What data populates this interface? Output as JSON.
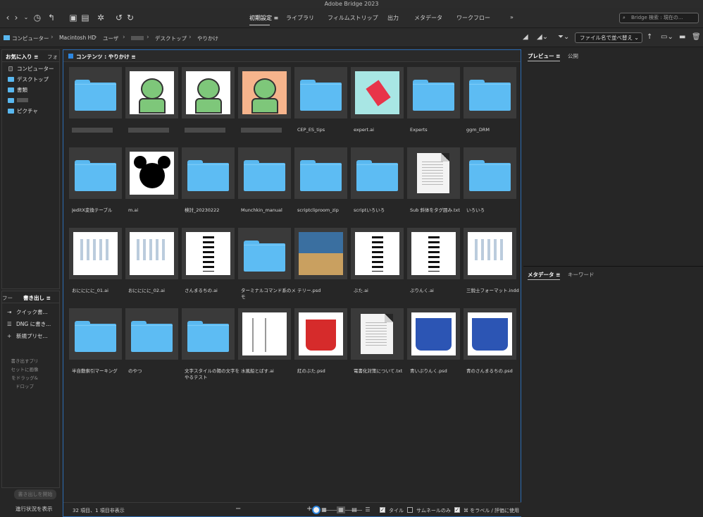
{
  "app": {
    "title": "Adobe Bridge 2023"
  },
  "workspaces": [
    "初期設定",
    "ライブラリ",
    "フィルムストリップ",
    "出力",
    "メタデータ",
    "ワークフロー"
  ],
  "workspace_active": "初期設定",
  "search": {
    "placeholder": "Bridge 検索 : 現在の..."
  },
  "path": [
    "コンピューター",
    "Macintosh HD",
    "ユーザ",
    "",
    "デスクトップ",
    "やりかけ"
  ],
  "sort": {
    "label": "ファイル名で並べ替え"
  },
  "left": {
    "tab_favorites": "お気に入り",
    "tab_folders": "フォ",
    "favorites": [
      {
        "label": "コンピューター",
        "icon": "computer-icon"
      },
      {
        "label": "デスクトップ",
        "icon": "folder-icon"
      },
      {
        "label": "書類",
        "icon": "folder-icon"
      },
      {
        "label": "",
        "icon": "folder-icon"
      },
      {
        "label": "ピクチャ",
        "icon": "folder-icon"
      }
    ]
  },
  "export": {
    "tab_left": "フー",
    "tab": "書き出し",
    "items": [
      "クイック書...",
      "DNG に書き...",
      "新規プリセ..."
    ],
    "hint": "書き出すプリセットに画像をドラッグ&ドロップ",
    "start": "書き出しを開始",
    "progress": "進行状況を表示"
  },
  "content": {
    "tab": "コンテンツ : やりかけ",
    "items": [
      {
        "name": "",
        "type": "folder"
      },
      {
        "name": "",
        "type": "image-frog"
      },
      {
        "name": "",
        "type": "image-frog"
      },
      {
        "name": "",
        "type": "image-frog-orange"
      },
      {
        "name": "CEP_ES_tips",
        "type": "folder"
      },
      {
        "name": "expert.ai",
        "type": "image-tag"
      },
      {
        "name": "Experts",
        "type": "folder"
      },
      {
        "name": "ggm_DRM",
        "type": "folder"
      },
      {
        "name": "JeditX変換テーブル",
        "type": "folder"
      },
      {
        "name": "m.ai",
        "type": "image-mouse"
      },
      {
        "name": "検討_20230222",
        "type": "folder"
      },
      {
        "name": "Munchkin_manual",
        "type": "folder"
      },
      {
        "name": "scriptcliproom_zip",
        "type": "folder"
      },
      {
        "name": "scriptいろいろ",
        "type": "folder"
      },
      {
        "name": "Sub 斜体をタグ囲み.txt",
        "type": "doc"
      },
      {
        "name": "いろいろ",
        "type": "folder"
      },
      {
        "name": "おにににに_01.ai",
        "type": "image-doc"
      },
      {
        "name": "おにににに_02.ai",
        "type": "image-doc"
      },
      {
        "name": "さんまるちの.ai",
        "type": "image-text"
      },
      {
        "name": "ターミナルコマンド系のメモ",
        "type": "folder"
      },
      {
        "name": "テリー.psd",
        "type": "image-photo"
      },
      {
        "name": "ぶた.ai",
        "type": "image-text"
      },
      {
        "name": "ぷりんく.ai",
        "type": "image-text"
      },
      {
        "name": "三鋭士フォーマット.indd",
        "type": "image-doc"
      },
      {
        "name": "半自動索引マーキング",
        "type": "folder"
      },
      {
        "name": "のやつ",
        "type": "folder"
      },
      {
        "name": "文字スタイルの陽の文字をやるテスト",
        "type": "folder"
      },
      {
        "name": "水風船とばす.ai",
        "type": "image-sketch"
      },
      {
        "name": "紅のぶた.psd",
        "type": "image-cup-red"
      },
      {
        "name": "電書化対策について.txt",
        "type": "doc"
      },
      {
        "name": "青いぷりんく.psd",
        "type": "image-cup-blue"
      },
      {
        "name": "青のさんまるちの.psd",
        "type": "image-cup-blue"
      }
    ]
  },
  "status": {
    "count": "32 項目、1 項目非表示",
    "tile": "タイル",
    "thumb_only": "サムネールのみ",
    "label_rating": "⌘ をラベル / 評価に使用"
  },
  "right": {
    "preview_tab": "プレビュー",
    "publish_tab": "公開",
    "metadata_tab": "メタデータ",
    "keyword_tab": "キーワード"
  },
  "colors": {
    "accent": "#2d86e0",
    "folder": "#5dbcf3",
    "bg": "#262626"
  }
}
